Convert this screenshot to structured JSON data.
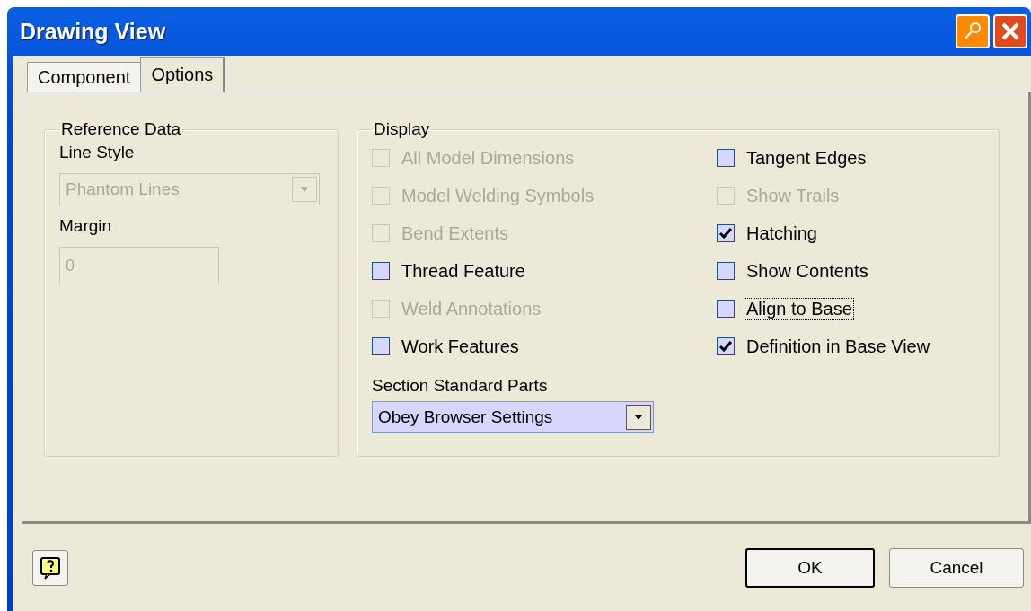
{
  "window": {
    "title": "Drawing View"
  },
  "tabs": [
    {
      "label": "Component",
      "selected": false
    },
    {
      "label": "Options",
      "selected": true
    }
  ],
  "reference_data": {
    "title": "Reference Data",
    "line_style": {
      "label": "Line Style",
      "value": "Phantom Lines",
      "disabled": true
    },
    "margin": {
      "label": "Margin",
      "value": "0",
      "disabled": true
    }
  },
  "display": {
    "title": "Display",
    "left": [
      {
        "label": "All Model Dimensions",
        "checked": false,
        "disabled": true,
        "focused": false
      },
      {
        "label": "Model Welding Symbols",
        "checked": false,
        "disabled": true,
        "focused": false
      },
      {
        "label": "Bend Extents",
        "checked": false,
        "disabled": true,
        "focused": false
      },
      {
        "label": "Thread Feature",
        "checked": false,
        "disabled": false,
        "focused": false
      },
      {
        "label": "Weld Annotations",
        "checked": false,
        "disabled": true,
        "focused": false
      },
      {
        "label": "Work Features",
        "checked": false,
        "disabled": false,
        "focused": false
      }
    ],
    "right": [
      {
        "label": "Tangent Edges",
        "checked": false,
        "disabled": false,
        "focused": false
      },
      {
        "label": "Show Trails",
        "checked": false,
        "disabled": true,
        "focused": false
      },
      {
        "label": "Hatching",
        "checked": true,
        "disabled": false,
        "focused": false
      },
      {
        "label": "Show Contents",
        "checked": false,
        "disabled": false,
        "focused": false
      },
      {
        "label": "Align to Base",
        "checked": false,
        "disabled": false,
        "focused": true
      },
      {
        "label": "Definition in Base View",
        "checked": true,
        "disabled": false,
        "focused": false
      }
    ],
    "section_standard_parts": {
      "label": "Section Standard Parts",
      "value": "Obey Browser Settings"
    }
  },
  "buttons": [
    {
      "label": "OK",
      "default": true
    },
    {
      "label": "Cancel",
      "default": false
    }
  ]
}
